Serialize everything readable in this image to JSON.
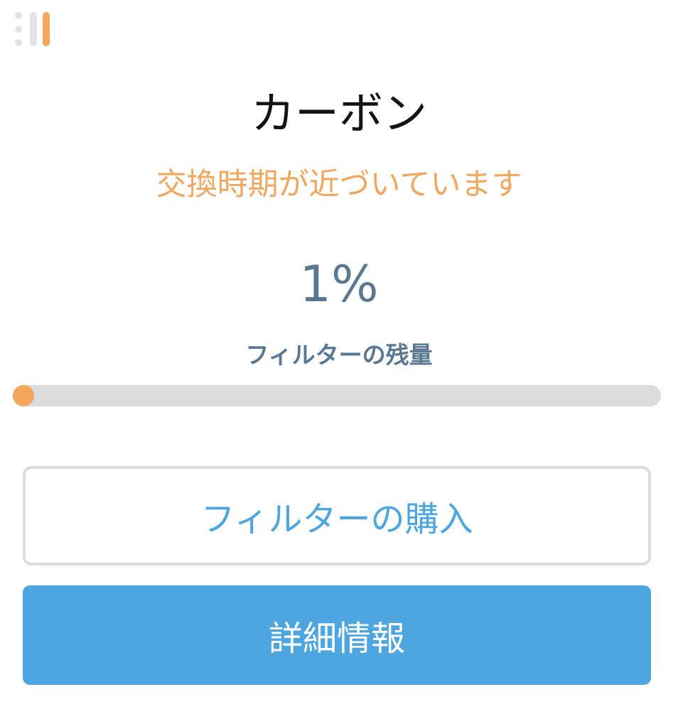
{
  "header": {
    "icon": "filter-status-icon"
  },
  "filter": {
    "name": "カーボン",
    "status": "交換時期が近づいています",
    "percent_text": "1%",
    "remaining_label": "フィルターの残量",
    "remaining_fraction": 0.01
  },
  "actions": {
    "buy_label": "フィルターの購入",
    "details_label": "詳細情報"
  },
  "colors": {
    "accent_orange": "#f2a65e",
    "primary_blue": "#4da6df",
    "slate_text": "#5a7891",
    "track_gray": "#dcdcdc"
  }
}
